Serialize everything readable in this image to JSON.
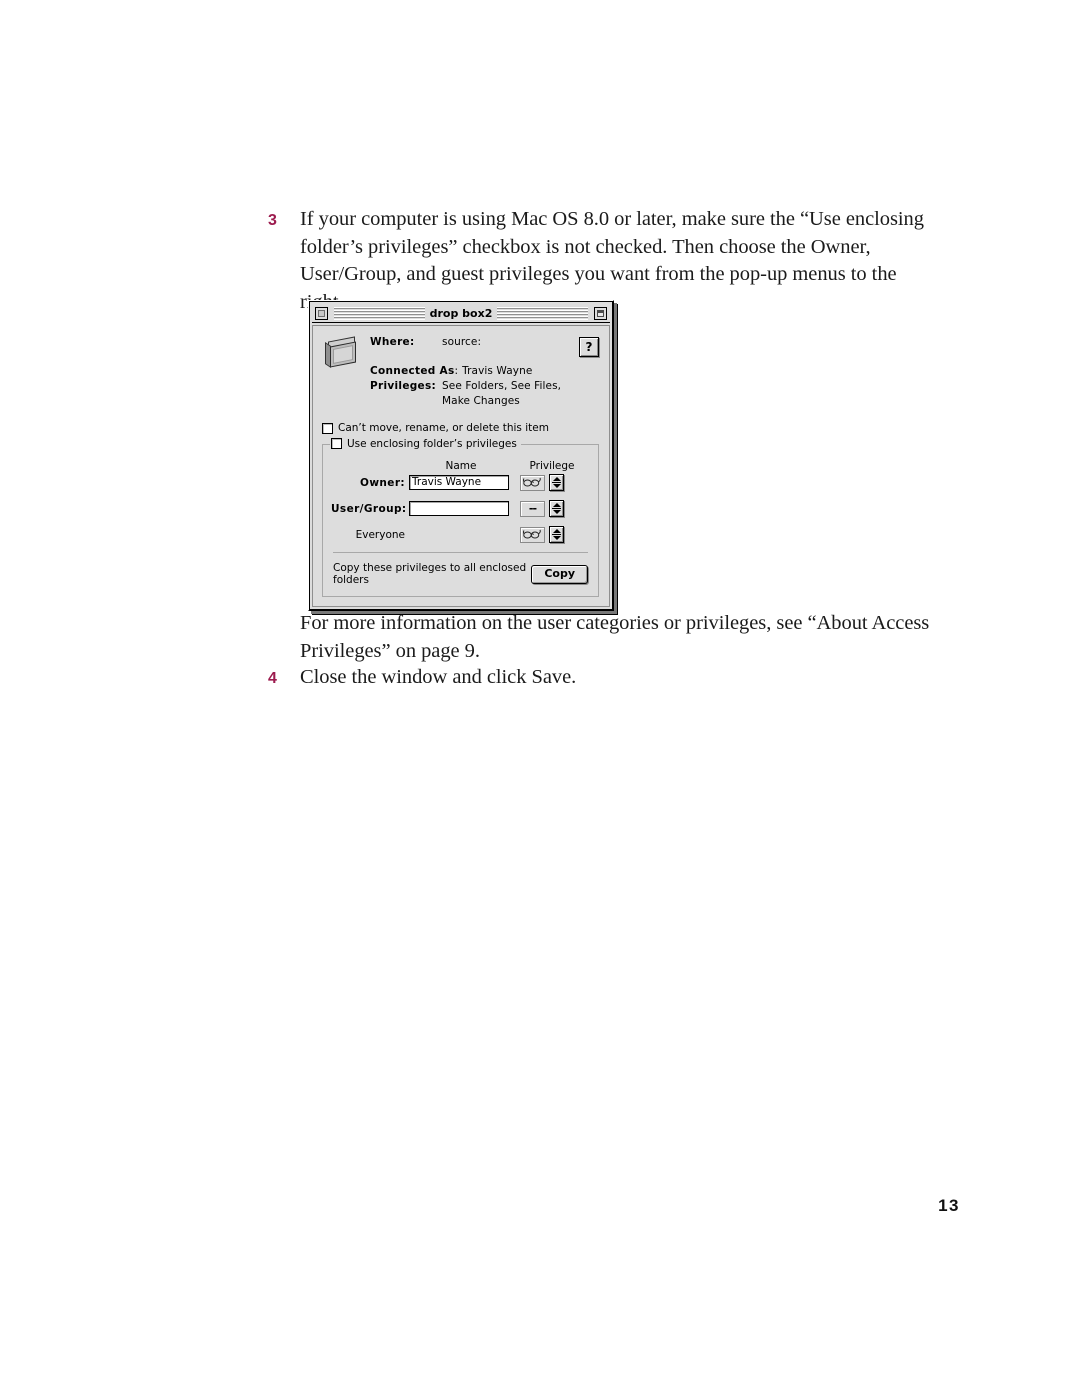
{
  "steps": [
    {
      "number": "3",
      "text": "If your computer is using Mac OS 8.0 or later, make sure the “Use enclosing folder’s privileges” checkbox is not checked. Then choose the Owner, User/Group, and guest privileges you want from the pop-up menus to the right."
    },
    {
      "number": "4",
      "text": "Close the window and click Save."
    }
  ],
  "note": "For more information on the user categories or privileges, see “About Access Privileges” on page 9.",
  "folio": "13",
  "dialog": {
    "title": "drop box2",
    "close_box": "close-box",
    "collapse_box": "collapse-box",
    "help_button": "?",
    "info": {
      "where_label": "Where:",
      "where_value": "source:",
      "connected_label": "Connected As",
      "connected_suffix": ":",
      "connected_value": "Travis Wayne",
      "privileges_label": "Privileges:",
      "privileges_value": "See Folders, See Files, Make Changes"
    },
    "lock_checkbox": {
      "label": "Can’t move, rename, or delete this item",
      "checked": false
    },
    "enclosing_checkbox": {
      "label": "Use enclosing folder’s privileges",
      "checked": false
    },
    "columns": {
      "name": "Name",
      "privilege": "Privilege"
    },
    "rows": [
      {
        "label": "Owner:",
        "bold": true,
        "field_value": "Travis Wayne",
        "has_field": true,
        "privilege_icon": "glasses-icon",
        "privilege_text": ""
      },
      {
        "label": "User/Group:",
        "bold": true,
        "field_value": "",
        "has_field": true,
        "privilege_icon": "dashes-icon",
        "privilege_text": "--"
      },
      {
        "label": "Everyone",
        "bold": false,
        "field_value": "",
        "has_field": false,
        "privilege_icon": "glasses-icon",
        "privilege_text": ""
      }
    ],
    "copy": {
      "text": "Copy these privileges to all enclosed folders",
      "button": "Copy"
    }
  },
  "colors": {
    "step_number": "#9c1b4e",
    "dialog_bg": "#dddddd",
    "text": "#1b1b1b"
  }
}
